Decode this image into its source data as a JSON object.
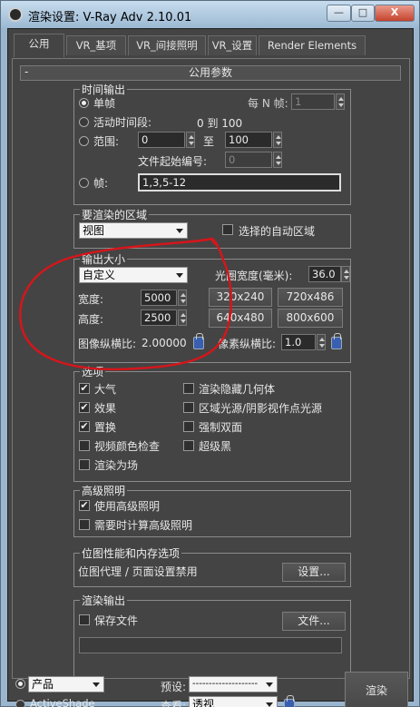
{
  "window": {
    "title": "渲染设置: V-Ray Adv 2.10.01",
    "btn_min": "—",
    "btn_max": "□",
    "btn_close": "X"
  },
  "tabs": [
    "公用",
    "VR_基项",
    "VR_间接照明",
    "VR_设置",
    "Render Elements"
  ],
  "rollout": {
    "title": "公用参数",
    "collapse": "-"
  },
  "time_output": {
    "title": "时间输出",
    "single": "单帧",
    "every_n": "每 N 帧:",
    "every_n_value": "1",
    "active_segment": "活动时间段:",
    "active_range": "0 到 100",
    "range": "范围:",
    "range_from": "0",
    "range_to_label": "至",
    "range_to": "100",
    "file_start": "文件起始编号:",
    "file_start_value": "0",
    "frames": "帧:",
    "frames_value": "1,3,5-12"
  },
  "render_area": {
    "title": "要渲染的区域",
    "selected": "视图",
    "auto_region": "选择的自动区域"
  },
  "output_size": {
    "title": "输出大小",
    "preset": "自定义",
    "aperture_label": "光圈宽度(毫米):",
    "aperture_value": "36.0",
    "width_label": "宽度:",
    "width_value": "5000",
    "height_label": "高度:",
    "height_value": "2500",
    "presets": [
      "320x240",
      "720x486",
      "640x480",
      "800x600"
    ],
    "image_aspect_label": "图像纵横比:",
    "image_aspect_value": "2.00000",
    "pixel_aspect_label": "像素纵横比:",
    "pixel_aspect_value": "1.0"
  },
  "options": {
    "title": "选项",
    "left": [
      {
        "label": "大气",
        "checked": true
      },
      {
        "label": "效果",
        "checked": true
      },
      {
        "label": "置换",
        "checked": true
      },
      {
        "label": "视频颜色检查",
        "checked": false
      },
      {
        "label": "渲染为场",
        "checked": false
      }
    ],
    "right": [
      {
        "label": "渲染隐藏几何体",
        "checked": false
      },
      {
        "label": "区域光源/阴影视作点光源",
        "checked": false
      },
      {
        "label": "强制双面",
        "checked": false
      },
      {
        "label": "超级黑",
        "checked": false
      }
    ]
  },
  "advanced_lighting": {
    "title": "高级照明",
    "use": "使用高级照明",
    "compute": "需要时计算高级照明"
  },
  "bitmap": {
    "title": "位图性能和内存选项",
    "text": "位图代理 / 页面设置禁用",
    "button": "设置..."
  },
  "render_output": {
    "title": "渲染输出",
    "save_file": "保存文件",
    "file_button": "文件..."
  },
  "bottom": {
    "mode_product": "产品",
    "mode_activeshade": "ActiveShade",
    "preset_label": "预设:",
    "preset_value": "--------------------",
    "view_label": "查看:",
    "view_value": "透视",
    "render_button": "渲染"
  },
  "chk": "✔"
}
